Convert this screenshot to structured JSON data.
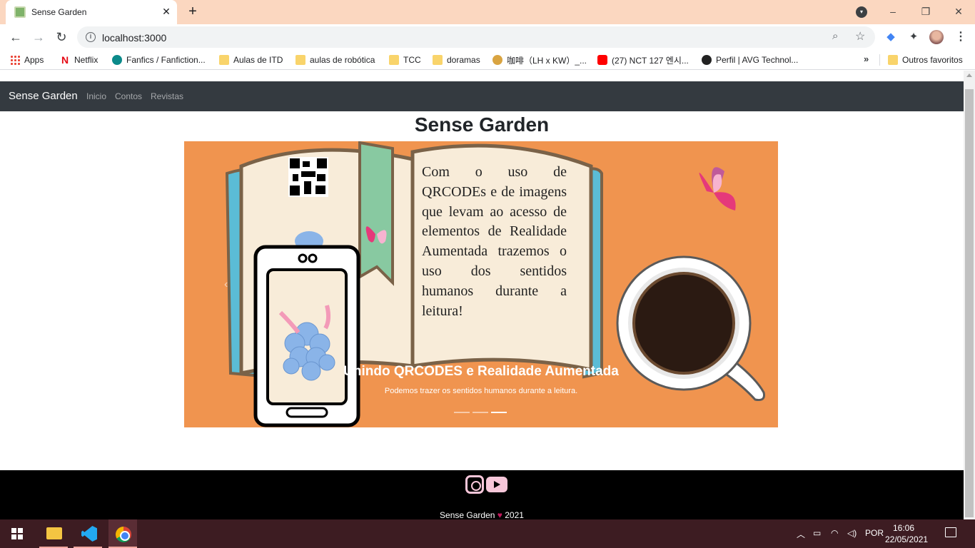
{
  "browser": {
    "tab_title": "Sense Garden",
    "tab_close": "✕",
    "new_tab": "+",
    "url": "localhost:3000",
    "icons": {
      "back": "arrow-left",
      "forward": "arrow-right",
      "reload": "reload",
      "info": "info",
      "zoom": "magnifier",
      "star": "star",
      "menu": "three-dots"
    },
    "window": {
      "minimize": "–",
      "restore": "❐",
      "close": "✕"
    },
    "bookmarks": [
      {
        "label": "Apps",
        "icon": "apps-grid-icon"
      },
      {
        "label": "Netflix",
        "icon": "netflix-icon"
      },
      {
        "label": "Fanfics / Fanfiction...",
        "icon": "ao3-icon"
      },
      {
        "label": "Aulas de ITD",
        "icon": "folder-icon"
      },
      {
        "label": "aulas de robótica",
        "icon": "folder-icon"
      },
      {
        "label": "TCC",
        "icon": "folder-icon"
      },
      {
        "label": "doramas",
        "icon": "folder-icon"
      },
      {
        "label": "咖啡（LH x KW）_...",
        "icon": "coffee-icon"
      },
      {
        "label": "(27) NCT 127 엔시...",
        "icon": "youtube-icon"
      },
      {
        "label": "Perfil | AVG Technol...",
        "icon": "avg-icon"
      }
    ],
    "bookmarks_more": "»",
    "other_bookmarks": "Outros favoritos"
  },
  "site": {
    "brand": "Sense Garden",
    "nav": [
      "Inicio",
      "Contos",
      "Revistas"
    ],
    "page_title": "Sense Garden",
    "carousel": {
      "slide_text": "Com o uso de QRCODEs e de imagens que levam ao acesso de elementos de Realidade Aumentada trazemos o uso dos sentidos humanos durante a leitura!",
      "caption_title": "Unindo QRCODES e Realidade Aumentada",
      "caption_text": "Podemos trazer os sentidos humanos durante a leitura.",
      "indicator_count": 3,
      "active_indicator": 3,
      "prev": "‹",
      "next": "›",
      "colors": {
        "background": "#f0944f",
        "book_page": "#f8ecd9",
        "book_cover": "#5bbcd6",
        "bookmark": "#88c9a1"
      }
    },
    "footer": {
      "brand": "Sense Garden",
      "heart": "♥",
      "year": "2021",
      "social_icons": [
        "instagram-icon",
        "youtube-icon"
      ],
      "icon_color": "#f7c6d9"
    }
  },
  "taskbar": {
    "apps": [
      "file-explorer-icon",
      "vscode-icon",
      "chrome-icon"
    ],
    "language": "POR",
    "time": "16:06",
    "date": "22/05/2021"
  }
}
